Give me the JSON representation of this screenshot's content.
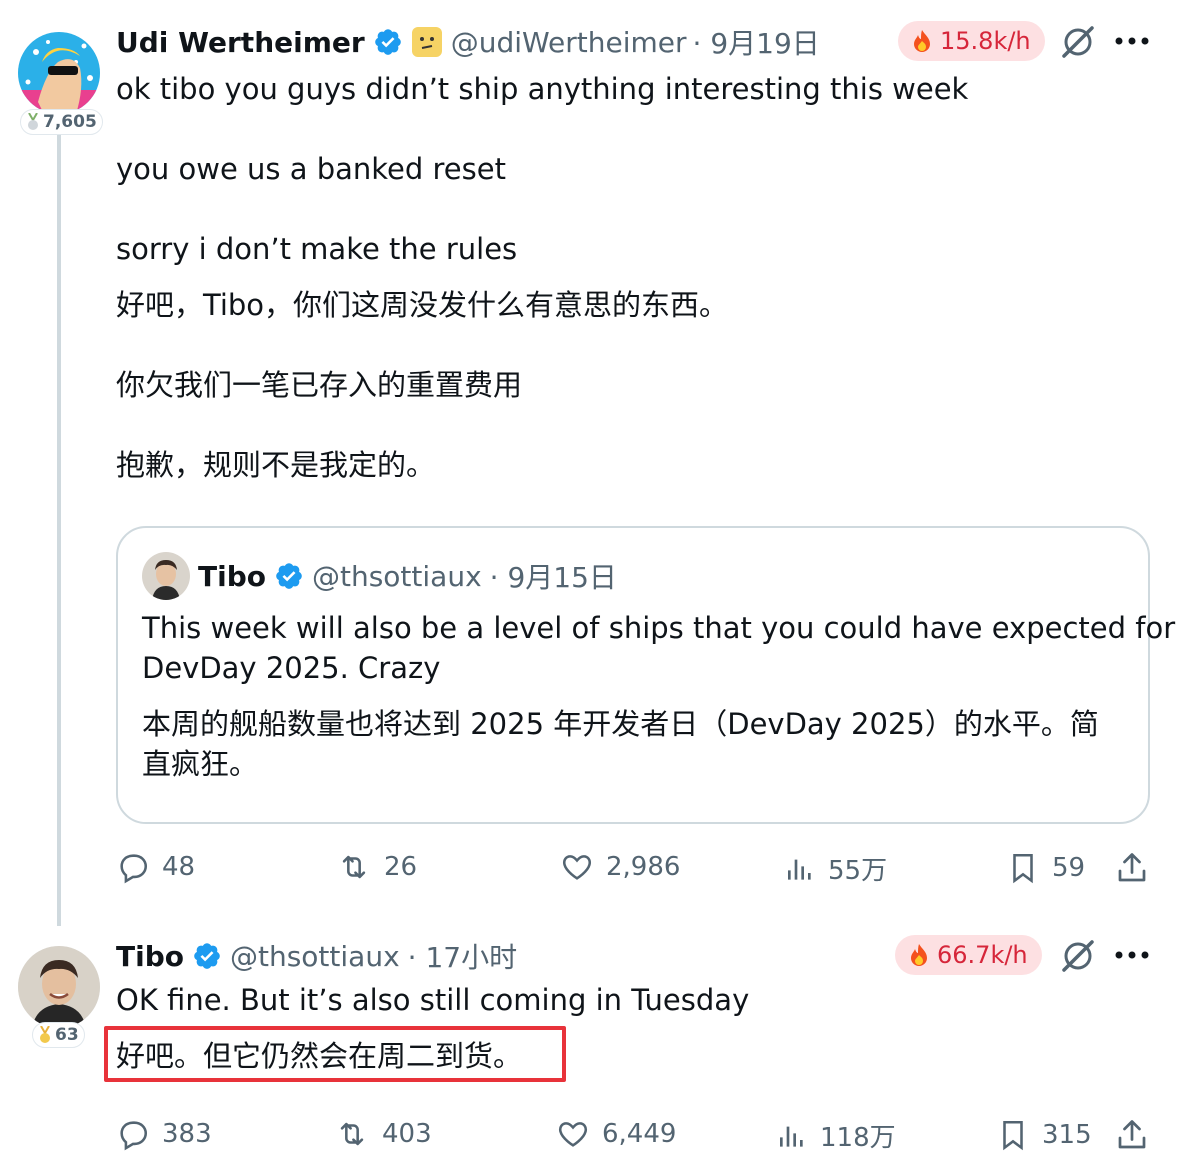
{
  "main_tweet": {
    "author_name": "Udi Wertheimer",
    "handle": "@udiWertheimer",
    "date": "· 9月19日",
    "rank": "7,605",
    "velocity": "15.8k/h",
    "text_en": [
      "ok tibo you guys didn’t ship anything interesting this week",
      "you owe us a banked reset",
      "sorry i don’t make the rules"
    ],
    "text_zh": [
      "好吧，Tibo，你们这周没发什么有意思的东西。",
      "你欠我们一笔已存入的重置费用",
      "抱歉，规则不是我定的。"
    ],
    "quote": {
      "author_name": "Tibo",
      "handle": "@thsottiaux",
      "date": "· 9月15日",
      "text_en": [
        "This week will also be a level of ships that you could have expected for",
        "DevDay 2025. Crazy"
      ],
      "text_zh": [
        "本周的舰船数量也将达到 2025 年开发者日（DevDay 2025）的水平。简",
        "直疯狂。"
      ]
    },
    "stats": {
      "replies": "48",
      "retweets": "26",
      "likes": "2,986",
      "views": "55万",
      "bookmarks": "59"
    }
  },
  "reply_tweet": {
    "author_name": "Tibo",
    "handle": "@thsottiaux",
    "date": "· 17小时",
    "rank": "63",
    "velocity": "66.7k/h",
    "text_en": "OK fine. But it’s also still coming in Tuesday",
    "text_zh": "好吧。但它仍然会在周二到货。",
    "stats": {
      "replies": "383",
      "retweets": "403",
      "likes": "6,449",
      "views": "118万",
      "bookmarks": "315"
    }
  },
  "colors": {
    "verified": "#1d9bf0",
    "velocity_bg": "#fde0e2",
    "velocity_text": "#d6263a",
    "highlight": "#e8323a",
    "secondary_text": "#536471"
  },
  "icons": [
    "verified-badge-icon",
    "emoji-badge-icon",
    "fire-icon",
    "grok-icon",
    "more-icon",
    "reply-icon",
    "retweet-icon",
    "like-icon",
    "views-icon",
    "bookmark-icon",
    "share-icon",
    "medal-icon"
  ]
}
